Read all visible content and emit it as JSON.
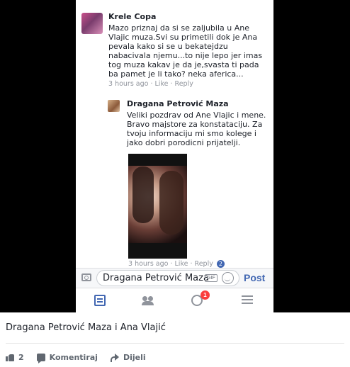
{
  "screenshot": {
    "comment": {
      "author": "Krele Copa",
      "text": "Mazo priznaj da si se zaljubila u Ane Vlajic muza.Svi su primetili dok je Ana pevala kako si se u bekatejdzu nabacivala njemu...to nije lepo jer imas tog muza kakav je da je,svasta ti pada ba pamet je li tako? neka aferica...",
      "meta": "3 hours ago · Like · Reply"
    },
    "reply": {
      "author": "Dragana Petrović Maza",
      "text": "Veliki pozdrav od Ane Vlajic i mene. Bravo majstore za konstataciju. Za tvoju informaciju mi smo kolege i jako dobri porodicni prijatelji.",
      "meta": "3 hours ago · Like · Reply",
      "reactions": "2"
    },
    "composer": {
      "value": "Dragana Petrović Maza",
      "gif_label": "GIF",
      "post_label": "Post"
    },
    "tabbar": {
      "notifications_badge": "1"
    }
  },
  "post": {
    "caption": "Dragana Petrović Maza i Ana Vlajić",
    "like_count": "2",
    "comment_label": "Komentiraj",
    "share_label": "Dijeli"
  },
  "colors": {
    "accent": "#4267b2",
    "badge": "#fa3e3e",
    "text": "#1d2129",
    "muted": "#90949c"
  }
}
